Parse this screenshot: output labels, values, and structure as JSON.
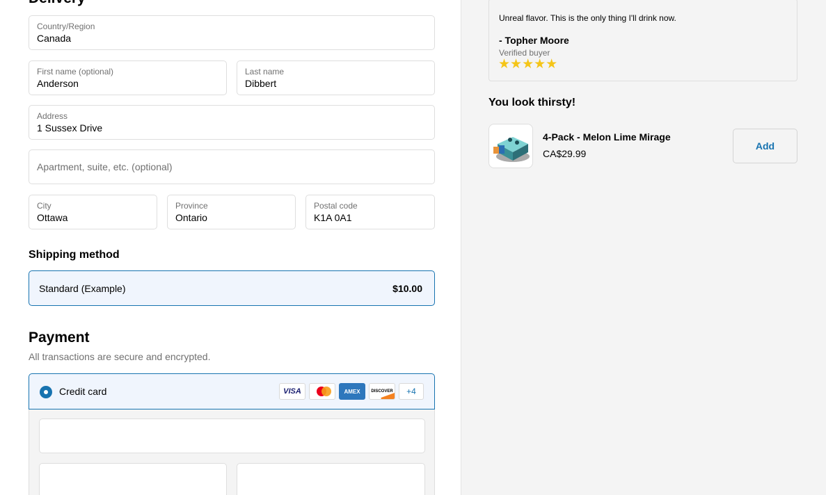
{
  "delivery": {
    "title": "Delivery",
    "country": {
      "label": "Country/Region",
      "value": "Canada"
    },
    "first_name": {
      "label": "First name (optional)",
      "value": "Anderson"
    },
    "last_name": {
      "label": "Last name",
      "value": "Dibbert"
    },
    "address": {
      "label": "Address",
      "value": "1 Sussex Drive"
    },
    "apartment": {
      "placeholder": "Apartment, suite, etc. (optional)"
    },
    "city": {
      "label": "City",
      "value": "Ottawa"
    },
    "province": {
      "label": "Province",
      "value": "Ontario"
    },
    "postal_code": {
      "label": "Postal code",
      "value": "K1A 0A1"
    }
  },
  "shipping": {
    "title": "Shipping method",
    "option_name": "Standard (Example)",
    "option_price": "$10.00"
  },
  "payment": {
    "title": "Payment",
    "subtitle": "All transactions are secure and encrypted.",
    "method_label": "Credit card",
    "card_brands": {
      "visa": "VISA",
      "mastercard": "mastercard-icon",
      "amex": "AMEX",
      "discover": "DISCOVER",
      "more": "+4"
    }
  },
  "review": {
    "quote": "Unreal flavor. This is the only thing I'll drink now.",
    "author": "- Topher Moore",
    "verified": "Verified buyer",
    "stars": "★★★★★",
    "rating": 5
  },
  "upsell": {
    "title": "You look thirsty!",
    "product_name": "4-Pack - Melon Lime Mirage",
    "product_price": "CA$29.99",
    "add_label": "Add"
  },
  "colors": {
    "accent": "#1773b0",
    "selected_bg": "#f0f5fd",
    "star": "#f5c518"
  }
}
